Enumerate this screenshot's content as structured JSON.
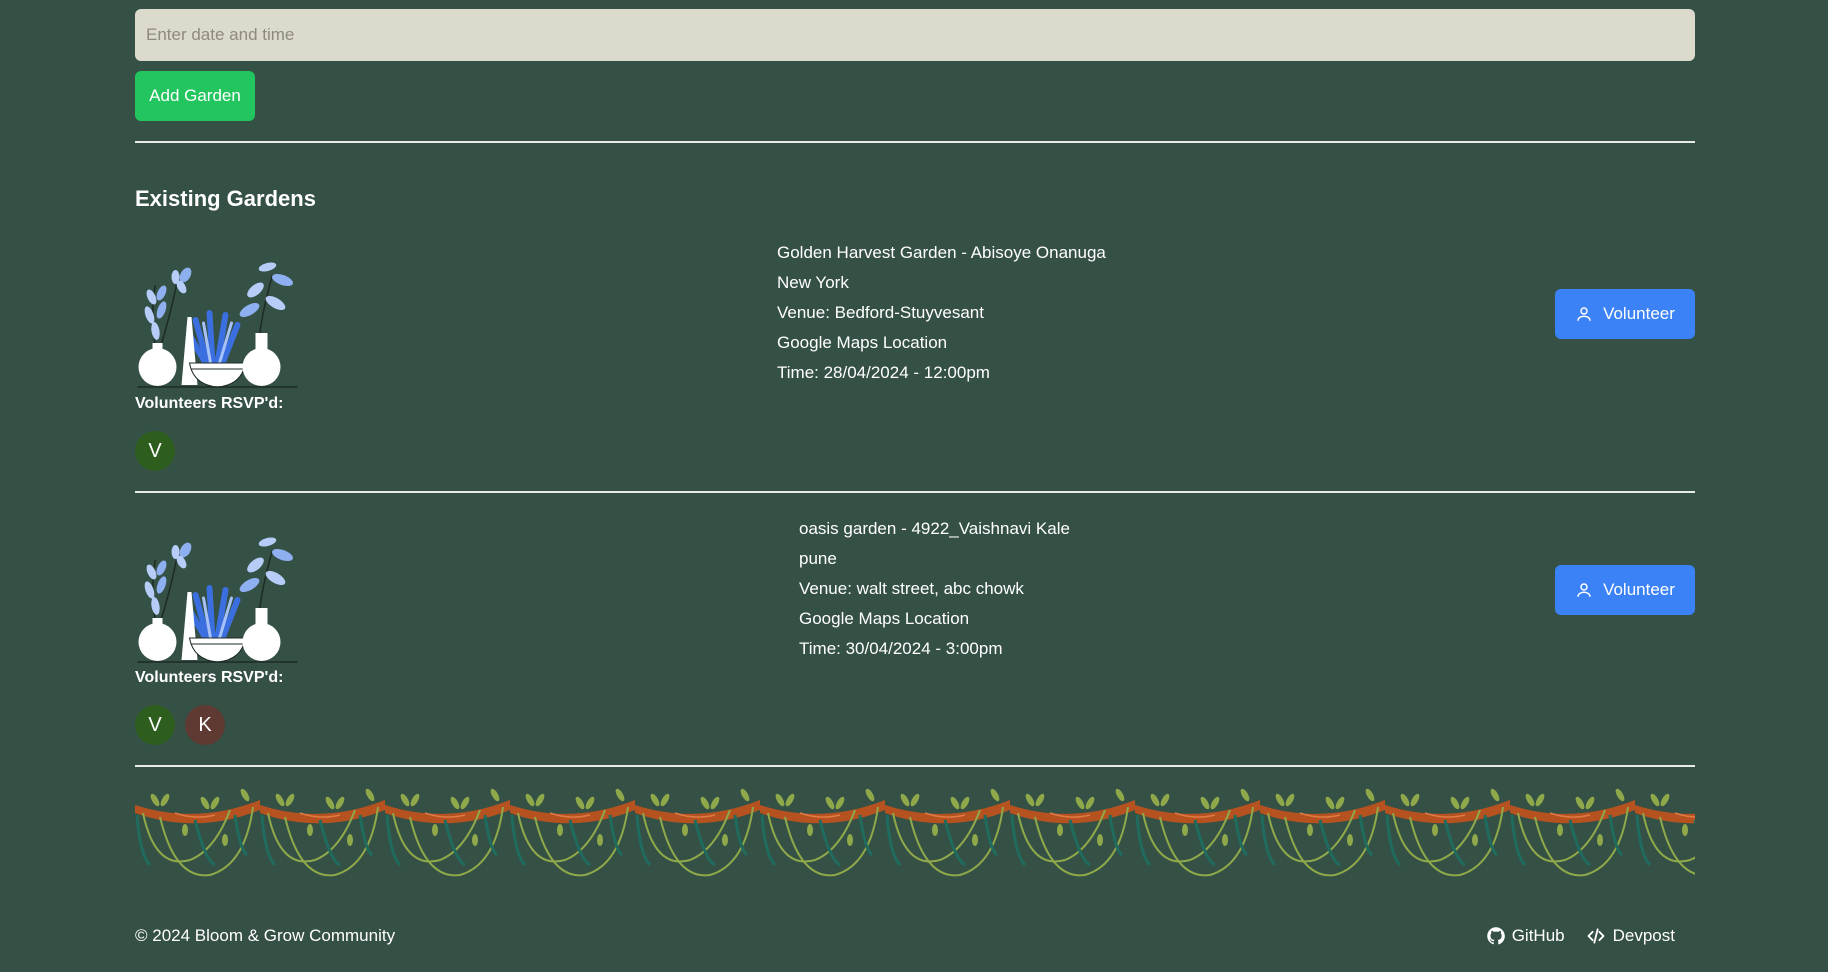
{
  "form": {
    "date_placeholder": "Enter date and time",
    "add_button": "Add Garden"
  },
  "section_title": "Existing Gardens",
  "gardens": [
    {
      "title": "Golden Harvest Garden - Abisoye Onanuga",
      "city": "New York",
      "venue": "Venue: Bedford-Stuyvesant",
      "maps": "Google Maps Location",
      "time": "Time: 28/04/2024 - 12:00pm",
      "volunteer_button": "Volunteer",
      "rsvp_label": "Volunteers RSVP'd:",
      "avatars": [
        {
          "initial": "V",
          "color": "#2e5e1e"
        }
      ]
    },
    {
      "title": "oasis garden - 4922_Vaishnavi Kale",
      "city": "pune",
      "venue": "Venue: walt street, abc chowk",
      "maps": "Google Maps Location",
      "time": "Time: 30/04/2024 - 3:00pm",
      "volunteer_button": "Volunteer",
      "rsvp_label": "Volunteers RSVP'd:",
      "avatars": [
        {
          "initial": "V",
          "color": "#2e5e1e"
        },
        {
          "initial": "K",
          "color": "#5e3a33"
        }
      ]
    }
  ],
  "footer": {
    "copyright": "© 2024 Bloom & Grow Community",
    "github": "GitHub",
    "devpost": "Devpost",
    "github_icon": "github-icon",
    "devpost_icon": "code-icon"
  },
  "colors": {
    "background": "#355045",
    "add_button": "#22c55e",
    "volunteer_button": "#3b82f6",
    "input_bg": "#dcd9cd"
  }
}
